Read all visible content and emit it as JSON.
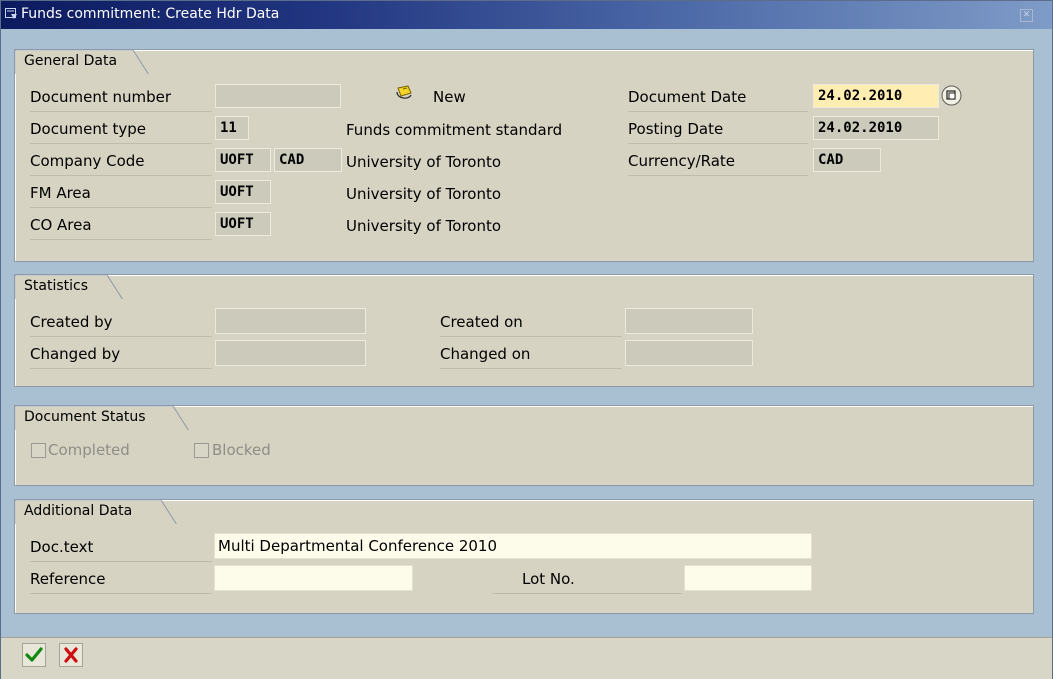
{
  "window": {
    "title": "Funds commitment: Create Hdr Data",
    "close_icon": "close-icon"
  },
  "general": {
    "title": "General Data",
    "doc_number_label": "Document number",
    "doc_number_value": "",
    "new_icon": "new-document-icon",
    "new_label": "New",
    "doc_type_label": "Document type",
    "doc_type_value": "11",
    "doc_type_text": "Funds commitment standard",
    "company_label": "Company Code",
    "company_value": "UOFT",
    "company_currency": "CAD",
    "company_text": "University of Toronto",
    "fm_label": "FM Area",
    "fm_value": "UOFT",
    "fm_text": "University of Toronto",
    "co_label": "CO Area",
    "co_value": "UOFT",
    "co_text": "University of Toronto",
    "doc_date_label": "Document Date",
    "doc_date_value": "24.02.2010",
    "posting_label": "Posting Date",
    "posting_value": "24.02.2010",
    "currency_label": "Currency/Rate",
    "currency_value": "CAD"
  },
  "statistics": {
    "title": "Statistics",
    "created_by_label": "Created by",
    "created_by_value": "",
    "changed_by_label": "Changed by",
    "changed_by_value": "",
    "created_on_label": "Created on",
    "created_on_value": "",
    "changed_on_label": "Changed on",
    "changed_on_value": ""
  },
  "status": {
    "title": "Document Status",
    "completed_label": "Completed",
    "completed_checked": false,
    "blocked_label": "Blocked",
    "blocked_checked": false
  },
  "additional": {
    "title": "Additional Data",
    "doc_text_label": "Doc.text",
    "doc_text_value": "Multi Departmental Conference 2010",
    "reference_label": "Reference",
    "reference_value": "",
    "lot_label": "Lot No.",
    "lot_value": ""
  },
  "footer": {
    "confirm_icon": "checkmark-icon",
    "cancel_icon": "cancel-x-icon"
  },
  "colors": {
    "title_dark": "#0c1a5e",
    "group_bg": "#d6d3c2",
    "required_bg": "#ffedb2",
    "window_bg": "#a9c0d2"
  }
}
